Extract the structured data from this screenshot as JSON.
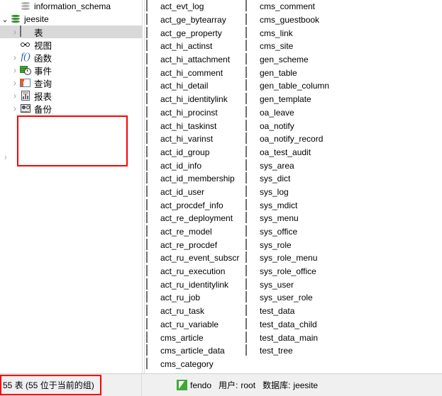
{
  "tree": {
    "items": [
      {
        "label": "information_schema",
        "icon": "database-icon-grey",
        "indent": 2,
        "twisty": "",
        "selected": false
      },
      {
        "label": "jeesite",
        "icon": "database-icon-green",
        "indent": 1,
        "twisty": "expanded",
        "selected": false
      },
      {
        "label": "表",
        "icon": "table-icon",
        "indent": 2,
        "twisty": "collapsed",
        "selected": true
      },
      {
        "label": "视图",
        "icon": "view-icon",
        "indent": 2,
        "twisty": "",
        "selected": false
      },
      {
        "label": "函数",
        "icon": "function-icon",
        "indent": 2,
        "twisty": "collapsed",
        "selected": false
      },
      {
        "label": "事件",
        "icon": "event-icon",
        "indent": 2,
        "twisty": "collapsed",
        "selected": false
      },
      {
        "label": "查询",
        "icon": "query-icon",
        "indent": 2,
        "twisty": "collapsed",
        "selected": false
      },
      {
        "label": "报表",
        "icon": "report-icon",
        "indent": 2,
        "twisty": "collapsed",
        "selected": false
      },
      {
        "label": "备份",
        "icon": "backup-icon",
        "indent": 2,
        "twisty": "collapsed",
        "selected": false
      }
    ],
    "edge_twisty": "›",
    "annotation_color": "#ff0000"
  },
  "table_list": {
    "column_1": [
      "act_evt_log",
      "act_ge_bytearray",
      "act_ge_property",
      "act_hi_actinst",
      "act_hi_attachment",
      "act_hi_comment",
      "act_hi_detail",
      "act_hi_identitylink",
      "act_hi_procinst",
      "act_hi_taskinst",
      "act_hi_varinst",
      "act_id_group",
      "act_id_info",
      "act_id_membership",
      "act_id_user",
      "act_procdef_info",
      "act_re_deployment",
      "act_re_model",
      "act_re_procdef",
      "act_ru_event_subscr",
      "act_ru_execution",
      "act_ru_identitylink",
      "act_ru_job",
      "act_ru_task",
      "act_ru_variable",
      "cms_article",
      "cms_article_data",
      "cms_category"
    ],
    "column_2": [
      "cms_comment",
      "cms_guestbook",
      "cms_link",
      "cms_site",
      "gen_scheme",
      "gen_table",
      "gen_table_column",
      "gen_template",
      "oa_leave",
      "oa_notify",
      "oa_notify_record",
      "oa_test_audit",
      "sys_area",
      "sys_dict",
      "sys_log",
      "sys_mdict",
      "sys_menu",
      "sys_office",
      "sys_role",
      "sys_role_menu",
      "sys_role_office",
      "sys_user",
      "sys_user_role",
      "test_data",
      "test_data_child",
      "test_data_main",
      "test_tree"
    ]
  },
  "status_bar": {
    "left_text": "55 表 (55 位于当前的组)",
    "brand": "fendo",
    "user_label": "用户:",
    "user_value": "root",
    "database_label": "数据库:",
    "database_value": "jeesite"
  }
}
